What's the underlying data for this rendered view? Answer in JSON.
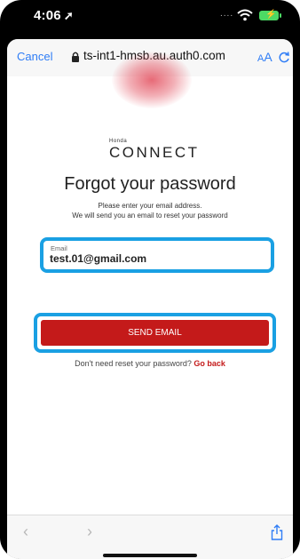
{
  "status_bar": {
    "time": "4:06",
    "location_symbol": "➚",
    "signal": "....",
    "battery_symbol": "⚡"
  },
  "browser": {
    "cancel_label": "Cancel",
    "url": "ts-int1-hmsb.au.auth0.com",
    "aa_label_small": "A",
    "aa_label_big": "A",
    "back_arrow": "‹",
    "forward_arrow": "›"
  },
  "page": {
    "logo_small": "Honda",
    "logo": "CONNECT",
    "title": "Forgot your password",
    "instructions_line1": "Please enter your email address.",
    "instructions_line2": "We will send you an email to reset your password",
    "email_label": "Email",
    "email_value": "test.01@gmail.com",
    "send_button": "SEND EMAIL",
    "back_prompt": "Don't need reset your password?",
    "go_back": "Go back"
  },
  "colors": {
    "accent": "#1aa0e3",
    "brand_red": "#c41a1a",
    "link_blue": "#2f7df6"
  }
}
